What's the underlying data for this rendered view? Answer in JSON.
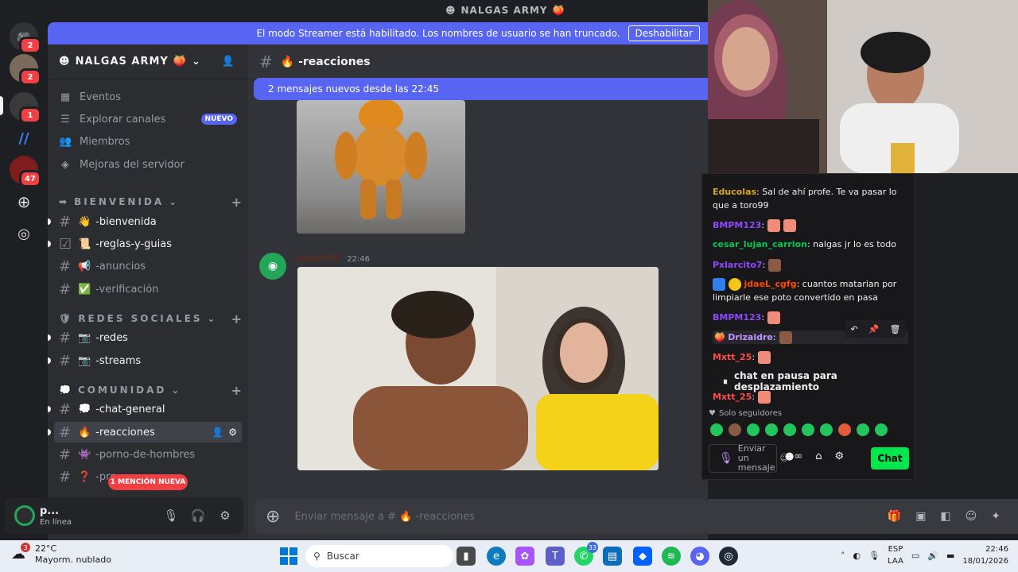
{
  "window_title": "NALGAS ARMY",
  "streamer_banner": {
    "text": "El modo Streamer está habilitado. Los nombres de usuario se han truncado.",
    "button": "Deshabilitar"
  },
  "servers": [
    {
      "icon": "discord-home-icon",
      "badge": "2"
    },
    {
      "icon": "avatar-server",
      "badge": "2"
    },
    {
      "icon": "avatar-server",
      "badge": "1"
    },
    {
      "icon": "blue-logo-server",
      "badge": ""
    },
    {
      "icon": "red-avatar-server",
      "badge": "47"
    },
    {
      "icon": "add-server-icon",
      "badge": ""
    },
    {
      "icon": "discover-icon",
      "badge": ""
    }
  ],
  "sidebar": {
    "server_name": "NALGAS ARMY",
    "nav": [
      {
        "label": "Eventos",
        "icon": "calendar-icon"
      },
      {
        "label": "Explorar canales",
        "icon": "list-icon",
        "tag": "NUEVO"
      },
      {
        "label": "Miembros",
        "icon": "members-icon"
      },
      {
        "label": "Mejoras del servidor",
        "icon": "boost-icon"
      }
    ],
    "categories": [
      {
        "name": "BIENVENIDA",
        "channels": [
          {
            "emoji": "👋",
            "name": "-bienvenida"
          },
          {
            "emoji": "📜",
            "name": "-reglas-y-guias"
          },
          {
            "emoji": "📢",
            "name": "-anuncios"
          },
          {
            "emoji": "✅",
            "name": "-verificación"
          }
        ]
      },
      {
        "name": "REDES SOCIALES",
        "channels": [
          {
            "emoji": "📷",
            "name": "-redes"
          },
          {
            "emoji": "📷",
            "name": "-streams"
          }
        ]
      },
      {
        "name": "COMUNIDAD",
        "channels": [
          {
            "emoji": "💭",
            "name": "-chat-general"
          },
          {
            "emoji": "🔥",
            "name": "-reacciones"
          },
          {
            "emoji": "👾",
            "name": "-porno-de-hombres"
          },
          {
            "emoji": "❓",
            "name": "-pre"
          }
        ]
      }
    ],
    "mention_pill": "1 MENCIÓN NUEVA"
  },
  "user_panel": {
    "name": "p...",
    "status": "En línea"
  },
  "main": {
    "channel_name": "🔥 -reacciones",
    "new_messages": "2 mensajes nuevos desde las 22:45",
    "message": {
      "author": "junior97",
      "time": "22:46"
    },
    "composer_placeholder": "Enviar mensaje a # 🔥 -reacciones"
  },
  "twitch_chat": {
    "messages": [
      {
        "user": "Educolas",
        "color": "#daa520",
        "text": "Sal de ahí profe. Te va pasar lo que a toro99"
      },
      {
        "user": "BMPM123",
        "color": "#9146ff",
        "text": ""
      },
      {
        "user": "cesar_lujan_carrion",
        "color": "#00c853",
        "text": "nalgas jr lo es todo"
      },
      {
        "user": "Pxlarcito7",
        "color": "#9146ff",
        "text": ""
      },
      {
        "user": "jdaeL_cgfg",
        "color": "#ff4500",
        "text": "cuantos matarian por limpiarle ese poto convertido en pasa"
      },
      {
        "user": "BMPM123",
        "color": "#9146ff",
        "text": ""
      },
      {
        "user": "Drizaidre",
        "color": "#bf94ff",
        "text": ""
      },
      {
        "user": "Mxtt_25",
        "color": "#ff4a4a",
        "text": ""
      },
      {
        "user": "Mxtt_25",
        "color": "#ff4a4a",
        "text": ""
      }
    ],
    "pause_text": "chat en pausa para desplazamiento",
    "followers_only": "Solo seguidores",
    "input_placeholder": "Enviar un mensaje",
    "chat_button": "Chat"
  },
  "taskbar": {
    "weather_temp": "22°C",
    "weather_desc": "Mayorm. nublado",
    "weather_badge": "3",
    "search": "Buscar",
    "whatsapp_badge": "33",
    "lang_top": "ESP",
    "lang_bottom": "LAA",
    "time": "22:46",
    "date": "18/01/2026"
  },
  "colors": {
    "accent": "#5865f2",
    "online": "#23a55a",
    "danger": "#f23f43",
    "twitch_chat_btn": "#00e64d"
  }
}
